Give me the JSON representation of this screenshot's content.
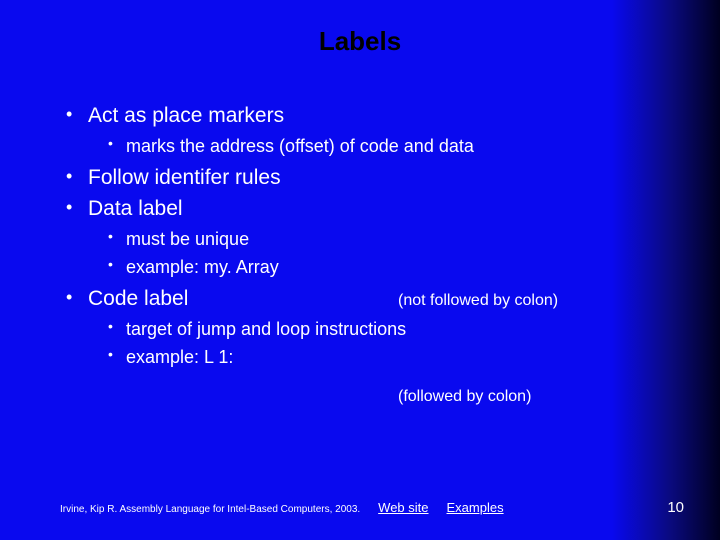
{
  "title": "Labels",
  "bullets": {
    "b1": "Act as place markers",
    "b1a": "marks the address (offset) of code and data",
    "b2": "Follow identifer rules",
    "b3": "Data label",
    "b3a": "must be unique",
    "b3b": "example:  my. Array",
    "b3b_note": "(not followed by colon)",
    "b4": "Code label",
    "b4a": "target of jump and loop instructions",
    "b4b": "example:   L 1:",
    "b4b_note": "(followed by colon)"
  },
  "footer": {
    "citation": "Irvine, Kip R. Assembly Language for Intel-Based Computers, 2003.",
    "link1": "Web site",
    "link2": "Examples",
    "page": "10"
  }
}
